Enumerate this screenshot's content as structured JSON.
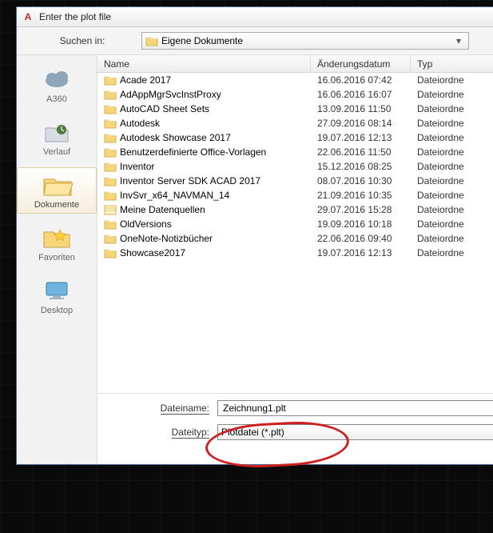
{
  "window": {
    "title": "Enter the plot file"
  },
  "toolbar": {
    "lookin_label": "Suchen in:",
    "lookin_value": "Eigene Dokumente"
  },
  "sidebar": {
    "places": [
      {
        "label": "A360",
        "icon": "cloud"
      },
      {
        "label": "Verlauf",
        "icon": "history"
      },
      {
        "label": "Dokumente",
        "icon": "folder-open",
        "selected": true
      },
      {
        "label": "Favoriten",
        "icon": "favorites"
      },
      {
        "label": "Desktop",
        "icon": "desktop"
      }
    ]
  },
  "columns": {
    "name": "Name",
    "date": "Änderungsdatum",
    "type": "Typ"
  },
  "items": [
    {
      "name": "Acade 2017",
      "date": "16.06.2016 07:42",
      "type": "Dateiordne",
      "icon": "folder"
    },
    {
      "name": "AdAppMgrSvcInstProxy",
      "date": "16.06.2016 16:07",
      "type": "Dateiordne",
      "icon": "folder"
    },
    {
      "name": "AutoCAD Sheet Sets",
      "date": "13.09.2016 11:50",
      "type": "Dateiordne",
      "icon": "folder"
    },
    {
      "name": "Autodesk",
      "date": "27.09.2016 08:14",
      "type": "Dateiordne",
      "icon": "folder"
    },
    {
      "name": "Autodesk Showcase 2017",
      "date": "19.07.2016 12:13",
      "type": "Dateiordne",
      "icon": "folder"
    },
    {
      "name": "Benutzerdefinierte Office-Vorlagen",
      "date": "22.06.2016 11:50",
      "type": "Dateiordne",
      "icon": "folder"
    },
    {
      "name": "Inventor",
      "date": "15.12.2016 08:25",
      "type": "Dateiordne",
      "icon": "folder"
    },
    {
      "name": "Inventor Server SDK ACAD 2017",
      "date": "08.07.2016 10:30",
      "type": "Dateiordne",
      "icon": "folder"
    },
    {
      "name": "InvSvr_x64_NAVMAN_14",
      "date": "21.09.2016 10:35",
      "type": "Dateiordne",
      "icon": "folder"
    },
    {
      "name": "Meine Datenquellen",
      "date": "29.07.2016 15:28",
      "type": "Dateiordne",
      "icon": "datasource"
    },
    {
      "name": "OldVersions",
      "date": "19.09.2016 10:18",
      "type": "Dateiordne",
      "icon": "folder"
    },
    {
      "name": "OneNote-Notizbücher",
      "date": "22.06.2016 09:40",
      "type": "Dateiordne",
      "icon": "folder"
    },
    {
      "name": "Showcase2017",
      "date": "19.07.2016 12:13",
      "type": "Dateiordne",
      "icon": "folder"
    }
  ],
  "bottom": {
    "filename_label": "Dateiname:",
    "filename_value": "Zeichnung1.plt",
    "filetype_label": "Dateityp:",
    "filetype_value": "Plotdatei (*.plt)"
  }
}
